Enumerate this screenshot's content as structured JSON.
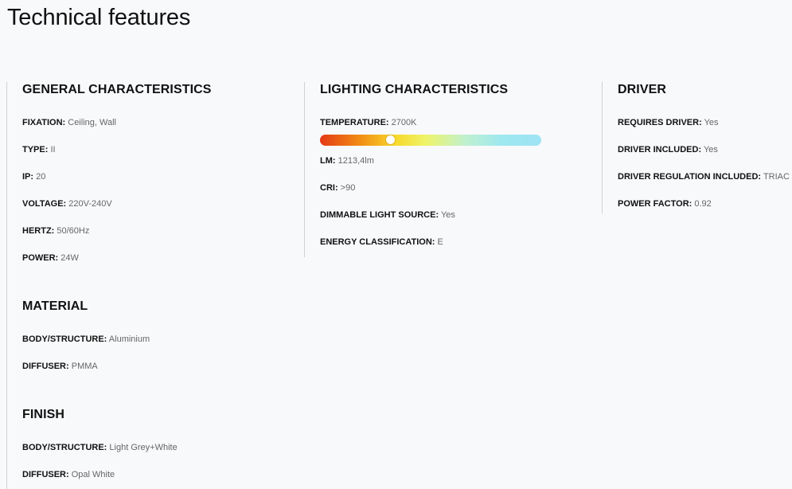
{
  "page": {
    "title": "Technical features"
  },
  "general": {
    "title": "GENERAL CHARACTERISTICS",
    "specs": [
      {
        "key": "FIXATION:",
        "value": "Ceiling, Wall"
      },
      {
        "key": "TYPE:",
        "value": "II"
      },
      {
        "key": "IP:",
        "value": "20"
      },
      {
        "key": "VOLTAGE:",
        "value": "220V-240V"
      },
      {
        "key": "HERTZ:",
        "value": "50/60Hz"
      },
      {
        "key": "POWER:",
        "value": "24W"
      }
    ]
  },
  "material": {
    "title": "MATERIAL",
    "specs": [
      {
        "key": "BODY/STRUCTURE:",
        "value": "Aluminium"
      },
      {
        "key": "DIFFUSER:",
        "value": "PMMA"
      }
    ]
  },
  "finish": {
    "title": "FINISH",
    "specs": [
      {
        "key": "BODY/STRUCTURE:",
        "value": "Light Grey+White"
      },
      {
        "key": "DIFFUSER:",
        "value": "Opal White"
      }
    ]
  },
  "lighting": {
    "title": "LIGHTING CHARACTERISTICS",
    "temperature": {
      "key": "TEMPERATURE:",
      "value": "2700K",
      "scale_position": 0.31
    },
    "specs": [
      {
        "key": "LM:",
        "value": "1213,4lm"
      },
      {
        "key": "CRI:",
        "value": ">90"
      },
      {
        "key": "DIMMABLE LIGHT SOURCE:",
        "value": "Yes"
      },
      {
        "key": "ENERGY CLASSIFICATION:",
        "value": "E"
      }
    ]
  },
  "driver": {
    "title": "DRIVER",
    "specs": [
      {
        "key": "REQUIRES DRIVER:",
        "value": "Yes"
      },
      {
        "key": "DRIVER INCLUDED:",
        "value": "Yes"
      },
      {
        "key": "DRIVER REGULATION INCLUDED:",
        "value": "TRIAC L"
      },
      {
        "key": "POWER FACTOR:",
        "value": "0.92"
      }
    ]
  },
  "colors": {
    "background": "#f8f9fb",
    "divider": "#cfd2d6",
    "text": "#111111",
    "muted": "#666666"
  }
}
